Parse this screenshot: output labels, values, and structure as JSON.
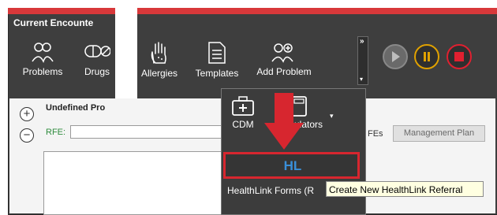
{
  "window": {
    "title": "Current Encounte"
  },
  "toolbar": {
    "buttons": [
      {
        "label": "Problems",
        "icon": "people-icon"
      },
      {
        "label": "Drugs",
        "icon": "pill-icon"
      },
      {
        "label": "Allergies",
        "icon": "hand-icon"
      },
      {
        "label": "Templates",
        "icon": "document-icon"
      },
      {
        "label": "Add Problem",
        "icon": "add-people-icon"
      }
    ],
    "overflow": {
      "top": "»",
      "bottom": "▾"
    },
    "media": {
      "play_color": "#8a8a8a",
      "pause_color": "#e0a100",
      "stop_color": "#e02030"
    }
  },
  "problem": {
    "title": "Undefined Pro",
    "add_symbol": "+",
    "remove_symbol": "−",
    "rfe_label": "RFE:",
    "rfe_value": ""
  },
  "tabs": {
    "rfes_partial": "FEs",
    "management_plan": "Management Plan"
  },
  "popup": {
    "cdm_label": "CDM",
    "calculators_label": "Calculators",
    "caret": "▾",
    "healthlink_logo": "HL",
    "healthlink_label": "HealthLink Forms (R"
  },
  "tooltip": {
    "text": "Create New HealthLink Referral"
  },
  "colors": {
    "accent_red": "#d7262f",
    "dark_bg": "#3e3e3e",
    "hl_blue": "#3a8fd8"
  }
}
